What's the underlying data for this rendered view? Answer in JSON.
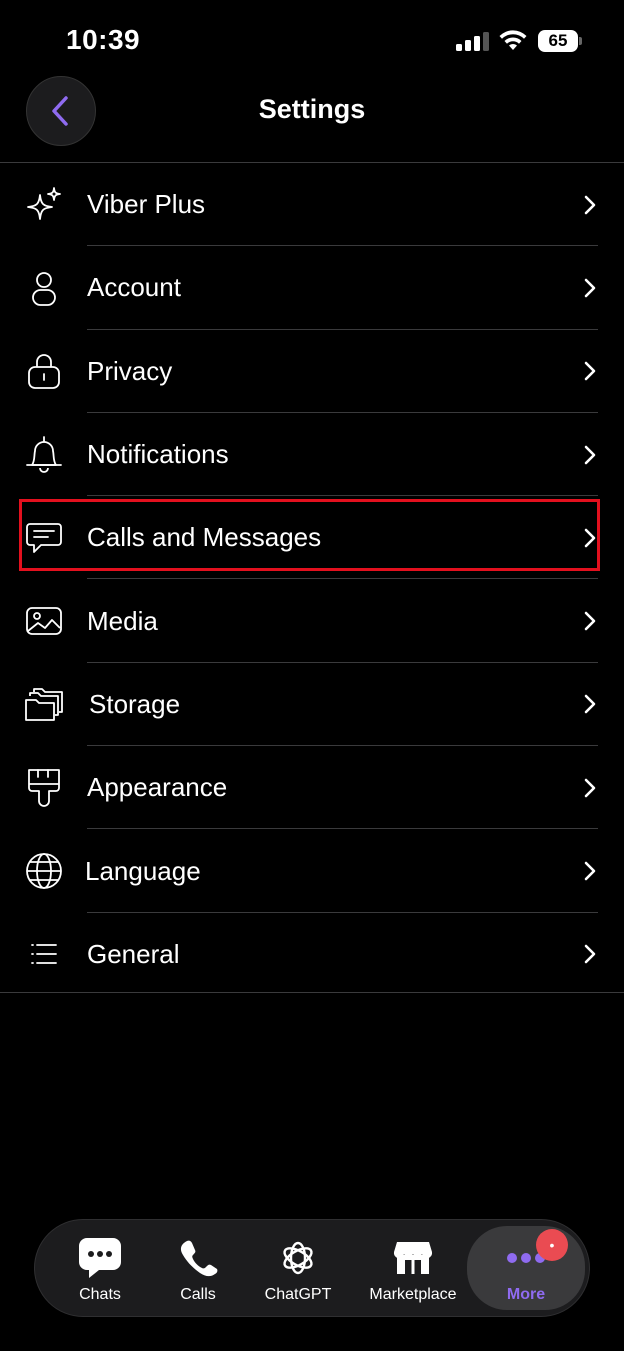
{
  "status_bar": {
    "time": "10:39",
    "battery": "65"
  },
  "header": {
    "title": "Settings",
    "back_icon": "chevron-left-icon"
  },
  "settings": [
    {
      "label": "Viber Plus",
      "icon": "sparkle-icon"
    },
    {
      "label": "Account",
      "icon": "person-icon"
    },
    {
      "label": "Privacy",
      "icon": "lock-icon"
    },
    {
      "label": "Notifications",
      "icon": "bell-icon"
    },
    {
      "label": "Calls and Messages",
      "icon": "chat-bubble-icon",
      "highlighted": true
    },
    {
      "label": "Media",
      "icon": "image-icon"
    },
    {
      "label": "Storage",
      "icon": "folders-icon"
    },
    {
      "label": "Appearance",
      "icon": "paintbrush-icon"
    },
    {
      "label": "Language",
      "icon": "globe-icon"
    },
    {
      "label": "General",
      "icon": "list-icon"
    }
  ],
  "bottom_nav": {
    "items": [
      {
        "label": "Chats",
        "icon": "chat-bubble-icon"
      },
      {
        "label": "Calls",
        "icon": "phone-icon"
      },
      {
        "label": "ChatGPT",
        "icon": "chatgpt-icon"
      },
      {
        "label": "Marketplace",
        "icon": "store-icon"
      },
      {
        "label": "More",
        "icon": "more-dots-icon",
        "active": true
      }
    ],
    "badge": "•"
  },
  "colors": {
    "accent": "#8f6bf0",
    "highlight": "#e3101e",
    "badge": "#ea4b52",
    "background": "#000000"
  }
}
